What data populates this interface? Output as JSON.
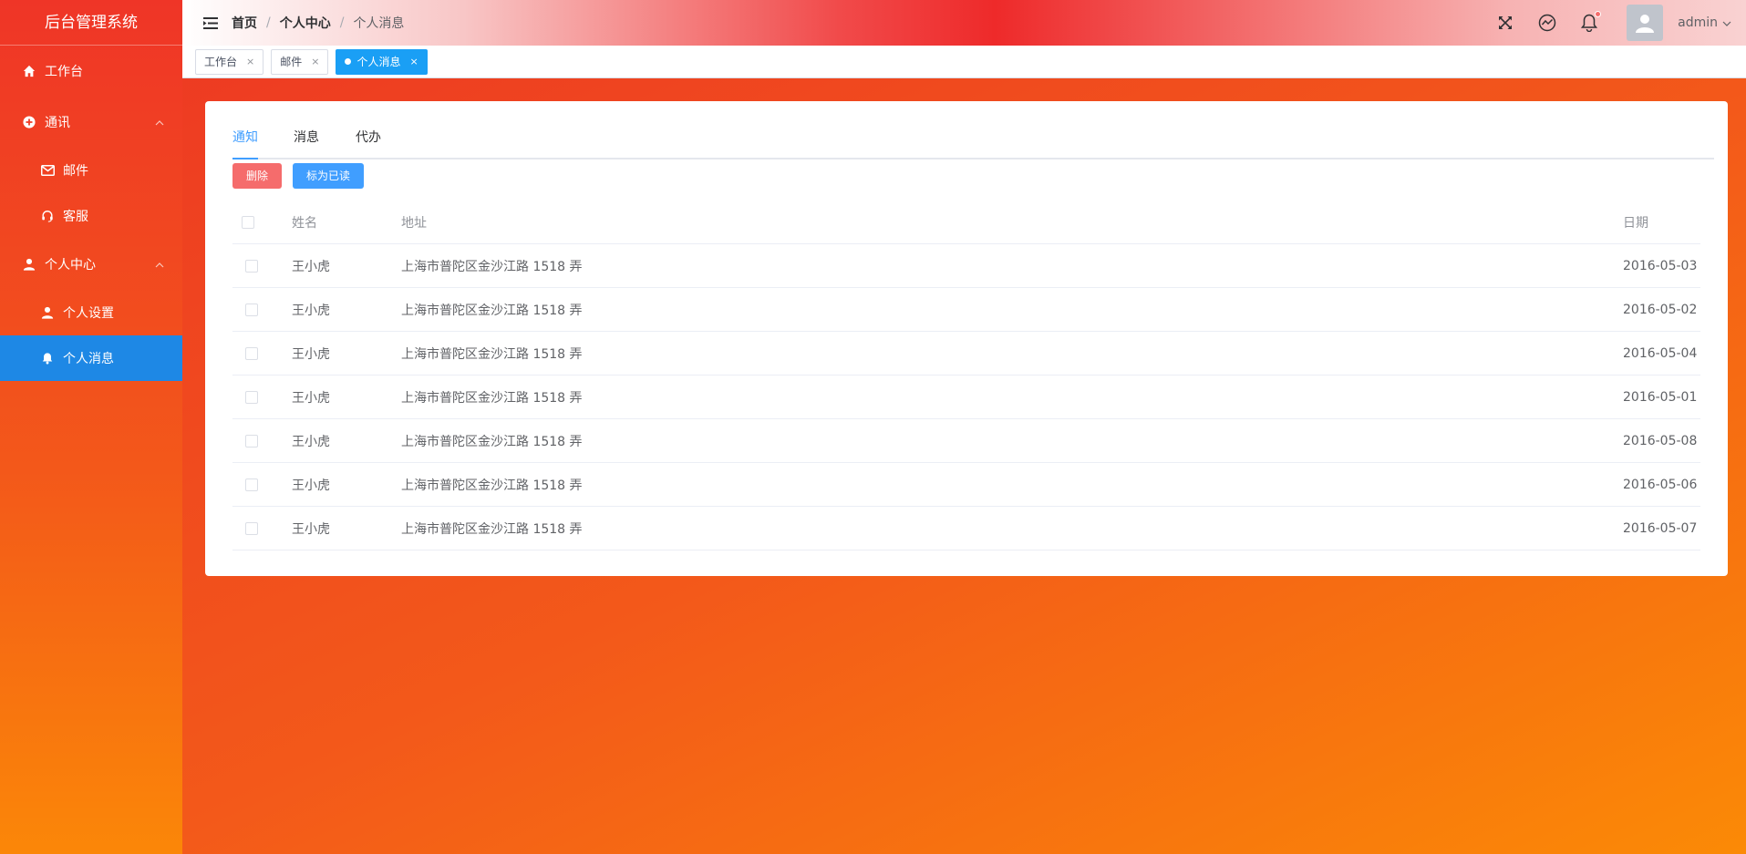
{
  "app": {
    "title": "后台管理系统"
  },
  "sidebar": {
    "items": [
      {
        "label": "工作台"
      },
      {
        "label": "通讯"
      },
      {
        "label": "邮件"
      },
      {
        "label": "客服"
      },
      {
        "label": "个人中心"
      },
      {
        "label": "个人设置"
      },
      {
        "label": "个人消息"
      }
    ]
  },
  "header": {
    "breadcrumb": [
      "首页",
      "个人中心",
      "个人消息"
    ],
    "separator": "/",
    "username": "admin"
  },
  "tags": [
    {
      "label": "工作台",
      "close": "×"
    },
    {
      "label": "邮件",
      "close": "×"
    },
    {
      "label": "个人消息",
      "close": "×"
    }
  ],
  "tabs": [
    {
      "label": "通知"
    },
    {
      "label": "消息"
    },
    {
      "label": "代办"
    }
  ],
  "buttons": {
    "delete": "删除",
    "mark_read": "标为已读"
  },
  "table": {
    "headers": {
      "name": "姓名",
      "address": "地址",
      "date": "日期"
    },
    "rows": [
      {
        "name": "王小虎",
        "address": "上海市普陀区金沙江路 1518 弄",
        "date": "2016-05-03"
      },
      {
        "name": "王小虎",
        "address": "上海市普陀区金沙江路 1518 弄",
        "date": "2016-05-02"
      },
      {
        "name": "王小虎",
        "address": "上海市普陀区金沙江路 1518 弄",
        "date": "2016-05-04"
      },
      {
        "name": "王小虎",
        "address": "上海市普陀区金沙江路 1518 弄",
        "date": "2016-05-01"
      },
      {
        "name": "王小虎",
        "address": "上海市普陀区金沙江路 1518 弄",
        "date": "2016-05-08"
      },
      {
        "name": "王小虎",
        "address": "上海市普陀区金沙江路 1518 弄",
        "date": "2016-05-06"
      },
      {
        "name": "王小虎",
        "address": "上海市普陀区金沙江路 1518 弄",
        "date": "2016-05-07"
      }
    ]
  },
  "colors": {
    "accent": "#409eff",
    "active_menu": "#1e88e5",
    "danger": "#f56c6c",
    "active_tag": "#1a9ff5"
  }
}
